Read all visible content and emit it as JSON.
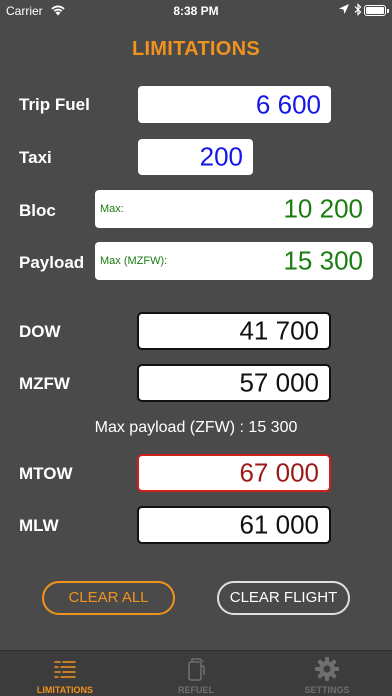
{
  "status_bar": {
    "carrier": "Carrier",
    "time": "8:38 PM"
  },
  "title": "LIMITATIONS",
  "rows": {
    "trip_fuel": {
      "label": "Trip Fuel",
      "value": "6 600"
    },
    "taxi": {
      "label": "Taxi",
      "value": "200"
    },
    "bloc": {
      "label": "Bloc",
      "sub": "Max:",
      "value": "10 200"
    },
    "payload": {
      "label": "Payload",
      "sub": "Max (MZFW):",
      "value": "15 300"
    },
    "dow": {
      "label": "DOW",
      "value": "41 700"
    },
    "mzfw": {
      "label": "MZFW",
      "value": "57 000"
    },
    "mtow": {
      "label": "MTOW",
      "value": "67 000"
    },
    "mlw": {
      "label": "MLW",
      "value": "61 000"
    }
  },
  "info": "Max payload (ZFW) : 15 300",
  "buttons": {
    "clear_all": "CLEAR ALL",
    "clear_flight": "CLEAR FLIGHT"
  },
  "tabs": [
    {
      "label": "LIMITATIONS",
      "icon": "limitations-list-icon",
      "active": true
    },
    {
      "label": "REFUEL",
      "icon": "fuel-can-icon",
      "active": false
    },
    {
      "label": "SETTINGS",
      "icon": "gear-icon",
      "active": false
    }
  ],
  "colors": {
    "background": "#4a4a4a",
    "accent": "#f0931e",
    "input_blue": "#1417e6",
    "input_green": "#1b7d10",
    "alert_red": "#d11f1f"
  }
}
